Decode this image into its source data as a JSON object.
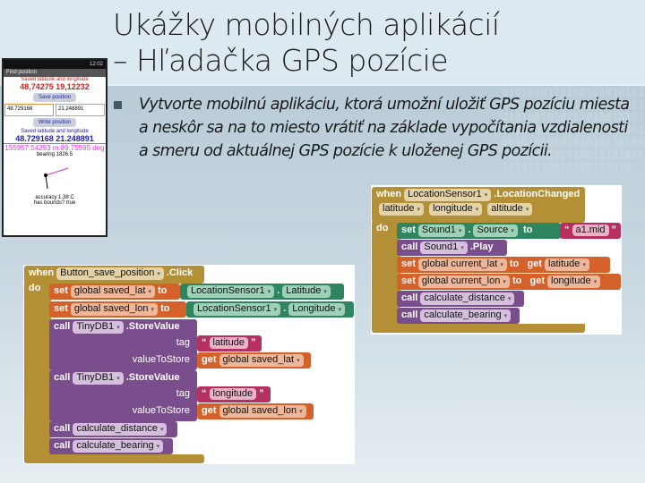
{
  "slide": {
    "title_line1": "Ukážky mobilných aplikácií",
    "title_line2": "– Hľadačka GPS pozície",
    "bullet": "Vytvorte mobilnú aplikáciu, ktorá umožní uložiť GPS pozíciu miesta a neskôr sa na to miesto vrátiť na základe vypočítania vzdialenosti a smeru od aktuálnej GPS pozície k uloženej GPS pozícii."
  },
  "phone": {
    "status": "12:02",
    "title": "Find position",
    "saved_label": "Saved latitude and longitude",
    "saved_values": "48,74275   19,12232",
    "save_button": "Save position",
    "lat_input": "48.729168",
    "lon_input": "21.248891",
    "write_button": "Write position",
    "current_label": "Saved latitude and longitude",
    "current_values": "48.729168   21.248891",
    "distance": "155957.54293 m   89.75595 deg",
    "bearing_label": "bearing 1826.5",
    "accuracy": "accuracy 1.38 C",
    "has_bounds": "has bounds? true"
  },
  "blocks_location": {
    "when": "when",
    "component": "LocationSensor1",
    "event": ".LocationChanged",
    "params": [
      "latitude",
      "longitude",
      "altitude"
    ],
    "do": "do",
    "row1": {
      "set": "set",
      "comp": "Sound1",
      "dot": ".",
      "prop": "Source",
      "to": "to",
      "text": "a1.mid"
    },
    "row2": {
      "call": "call",
      "comp": "Sound1",
      "method": ".Play"
    },
    "row3": {
      "set": "set",
      "var": "global current_lat",
      "to": "to",
      "get": "get",
      "val": "latitude"
    },
    "row4": {
      "set": "set",
      "var": "global current_lon",
      "to": "to",
      "get": "get",
      "val": "longitude"
    },
    "row5": {
      "call": "call",
      "proc": "calculate_distance"
    },
    "row6": {
      "call": "call",
      "proc": "calculate_bearing"
    }
  },
  "blocks_button": {
    "when": "when",
    "component": "Button_save_position",
    "event": ".Click",
    "do": "do",
    "row1": {
      "set": "set",
      "var": "global saved_lat",
      "to": "to",
      "comp": "LocationSensor1",
      "dot": ".",
      "prop": "Latitude"
    },
    "row2": {
      "set": "set",
      "var": "global saved_lon",
      "to": "to",
      "comp": "LocationSensor1",
      "dot": ".",
      "prop": "Longitude"
    },
    "store1": {
      "call": "call",
      "comp": "TinyDB1",
      "method": ".StoreValue",
      "tag": "tag",
      "tag_val": "latitude",
      "vts": "valueToStore",
      "get": "get",
      "var": "global saved_lat"
    },
    "store2": {
      "call": "call",
      "comp": "TinyDB1",
      "method": ".StoreValue",
      "tag": "tag",
      "tag_val": "longitude",
      "vts": "valueToStore",
      "get": "get",
      "var": "global saved_lon"
    },
    "row5": {
      "call": "call",
      "proc": "calculate_distance"
    },
    "row6": {
      "call": "call",
      "proc": "calculate_bearing"
    }
  },
  "colors": {
    "event": "#b38f36",
    "variable": "#d4602a",
    "component": "#2f8560",
    "procedure": "#7a4e8c",
    "text": "#b52f60"
  }
}
